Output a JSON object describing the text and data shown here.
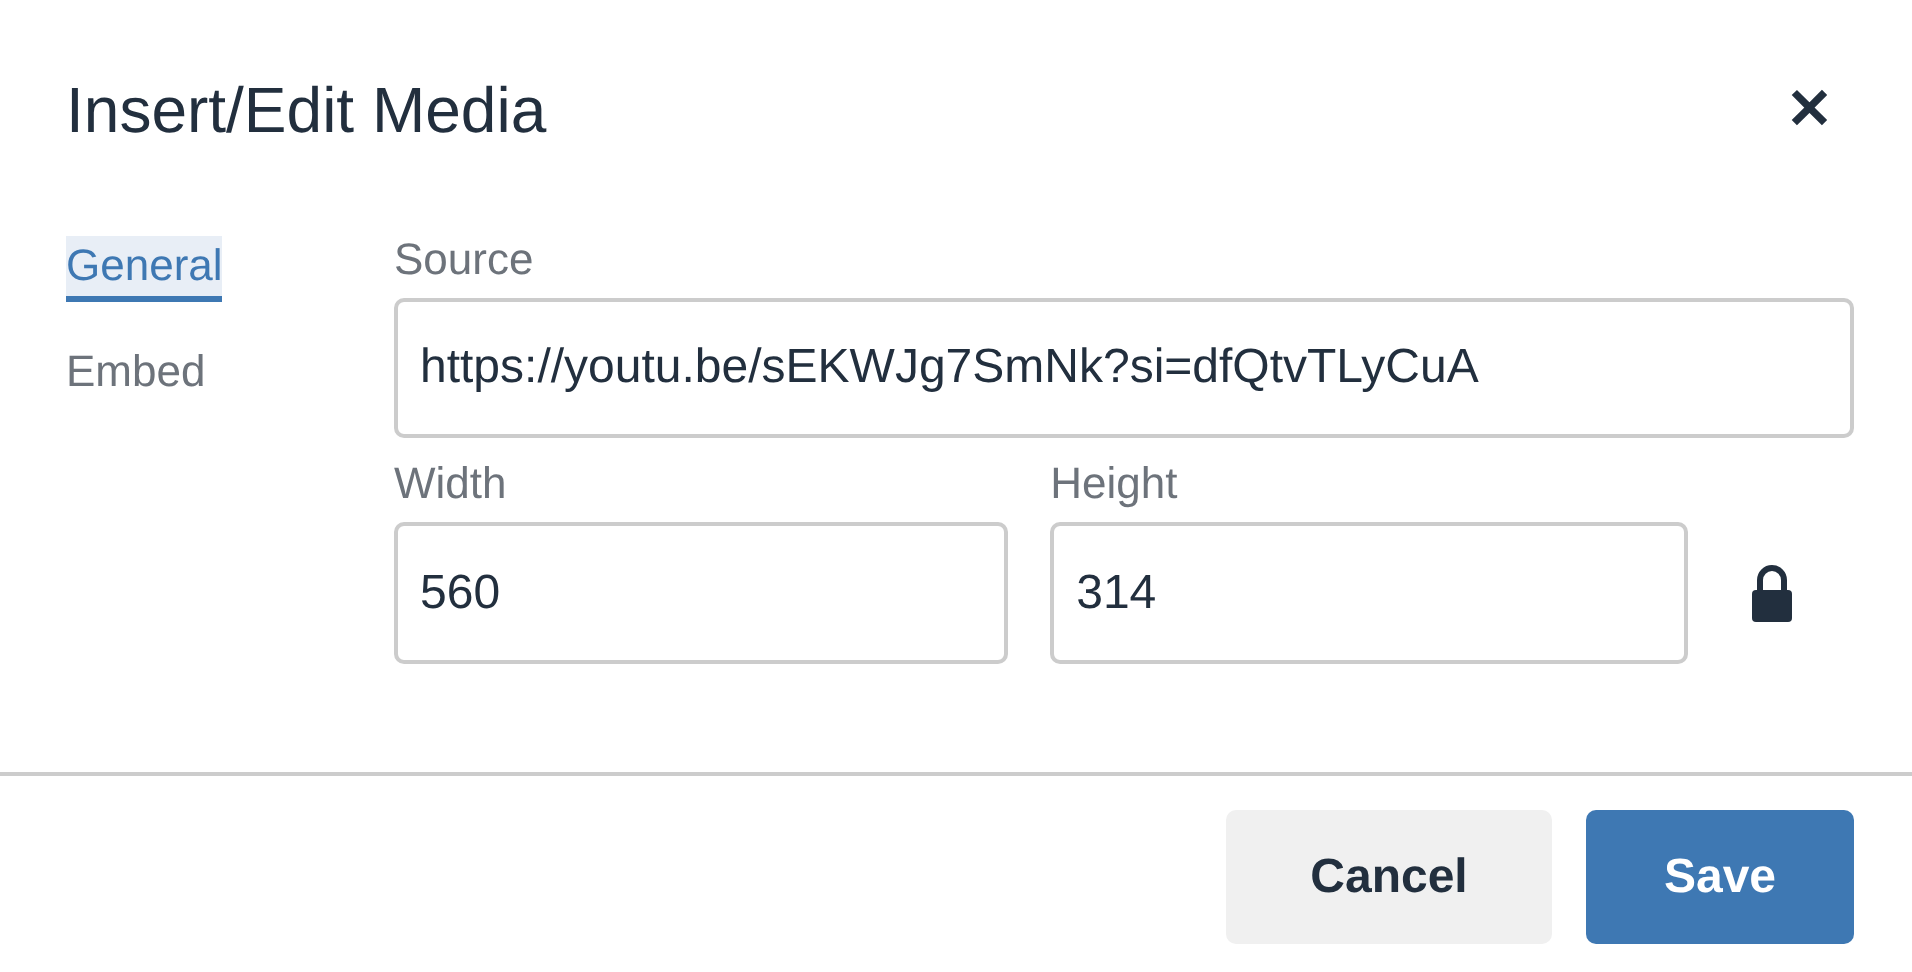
{
  "dialog": {
    "title": "Insert/Edit Media",
    "close_label": "✕"
  },
  "tabs": [
    {
      "label": "General",
      "selected": true
    },
    {
      "label": "Embed",
      "selected": false
    }
  ],
  "source": {
    "label": "Source",
    "value": "https://youtu.be/sEKWJg7SmNk?si=dfQtvTLyCuA"
  },
  "width": {
    "label": "Width",
    "value": "560"
  },
  "height": {
    "label": "Height",
    "value": "314"
  },
  "constrain_proportions": {
    "locked": true
  },
  "buttons": [
    {
      "label": "Cancel",
      "kind": "secondary"
    },
    {
      "label": "Save",
      "kind": "primary"
    }
  ]
}
